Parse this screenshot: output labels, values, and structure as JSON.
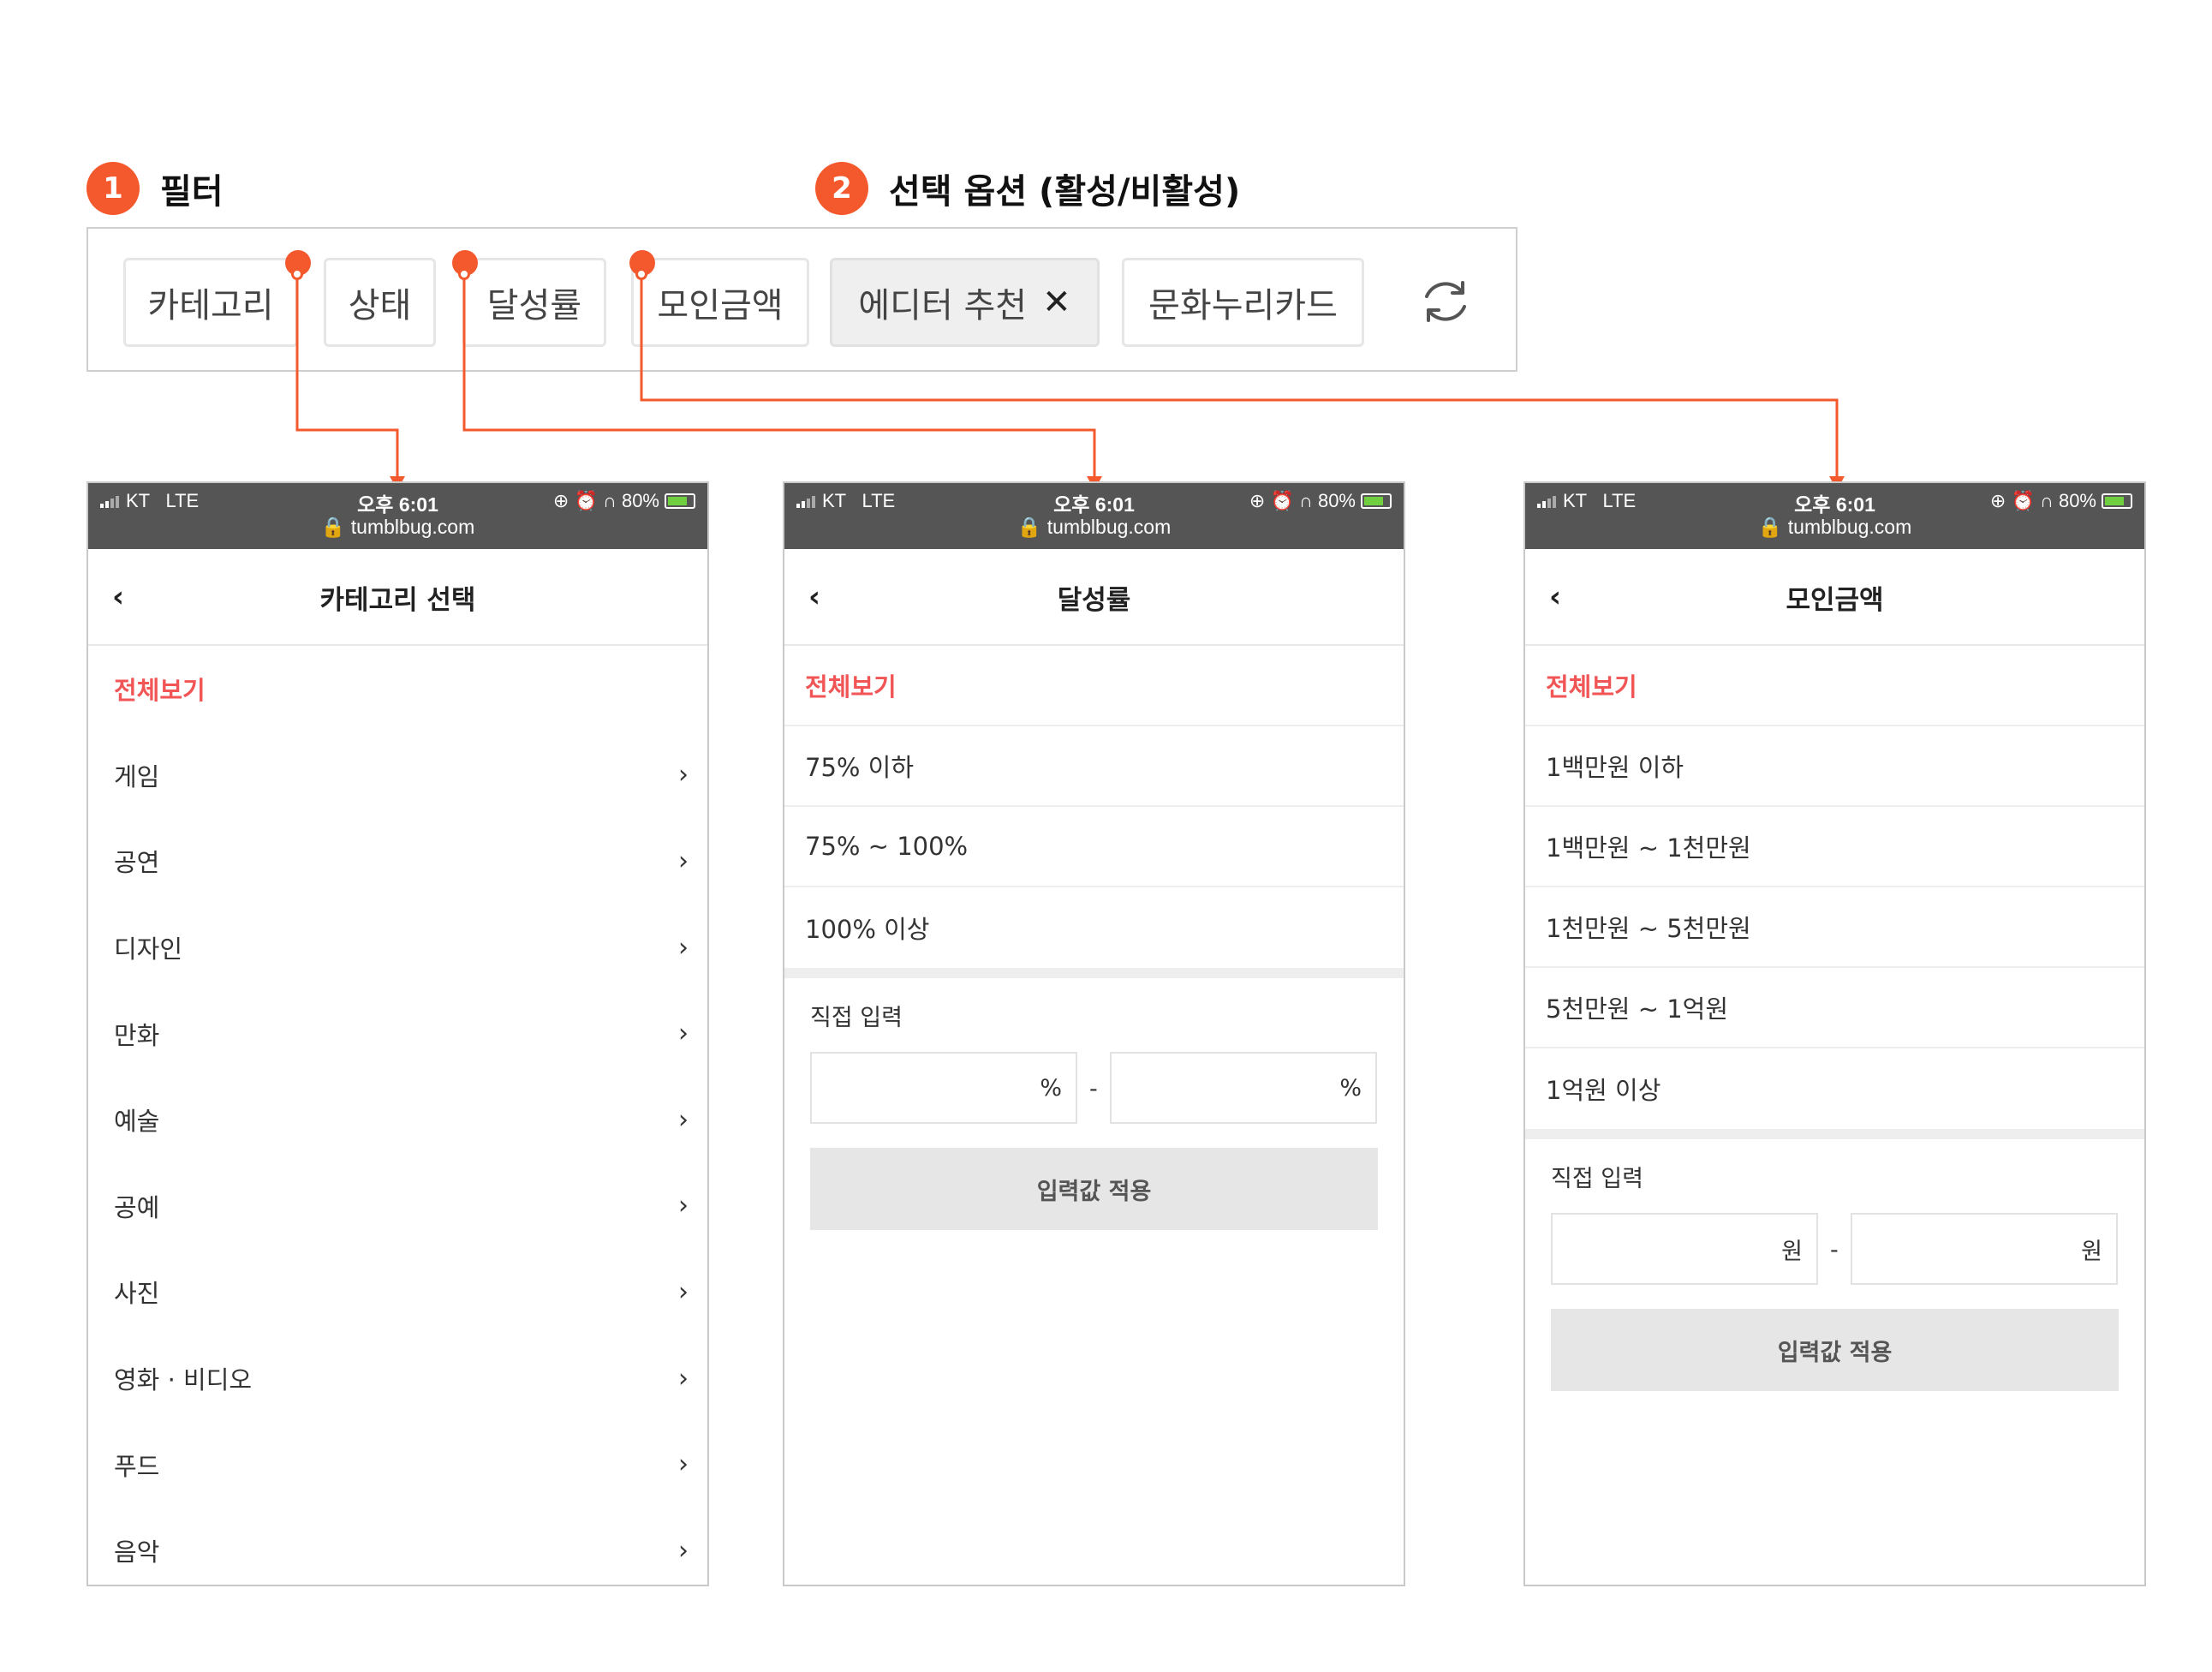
{
  "sections": [
    {
      "number": "1",
      "title": "필터"
    },
    {
      "number": "2",
      "title": "선택 옵션 (활성/비활성)"
    }
  ],
  "filters": {
    "chips": [
      {
        "label": "카테고리",
        "active": false
      },
      {
        "label": "상태",
        "active": false
      },
      {
        "label": "달성률",
        "active": false
      },
      {
        "label": "모인금액",
        "active": false
      },
      {
        "label": "에디터 추천",
        "active": true,
        "close": "✕"
      },
      {
        "label": "문화누리카드",
        "active": false
      }
    ],
    "refresh_icon": "refresh-icon"
  },
  "status_bar": {
    "carrier": "KT",
    "network": "LTE",
    "time": "오후 6:01",
    "url": "tumblbug.com",
    "battery": "80%"
  },
  "colors": {
    "accent": "#f4592e",
    "highlight_text": "#f25555",
    "status_bg": "#555555"
  },
  "category_screen": {
    "back": "‹",
    "title": "카테고리 선택",
    "all": "전체보기",
    "items": [
      "게임",
      "공연",
      "디자인",
      "만화",
      "예술",
      "공예",
      "사진",
      "영화 · 비디오",
      "푸드",
      "음악"
    ],
    "chevron": "›"
  },
  "rate_screen": {
    "back": "‹",
    "title": "달성률",
    "all": "전체보기",
    "options": [
      "75% 이하",
      "75% ~ 100%",
      "100% 이상"
    ],
    "direct_label": "직접 입력",
    "unit": "%",
    "dash": "-",
    "apply": "입력값 적용"
  },
  "amount_screen": {
    "back": "‹",
    "title": "모인금액",
    "all": "전체보기",
    "options": [
      "1백만원 이하",
      "1백만원 ~ 1천만원",
      "1천만원 ~ 5천만원",
      "5천만원 ~ 1억원",
      "1억원 이상"
    ],
    "direct_label": "직접 입력",
    "unit": "원",
    "dash": "-",
    "apply": "입력값 적용"
  }
}
